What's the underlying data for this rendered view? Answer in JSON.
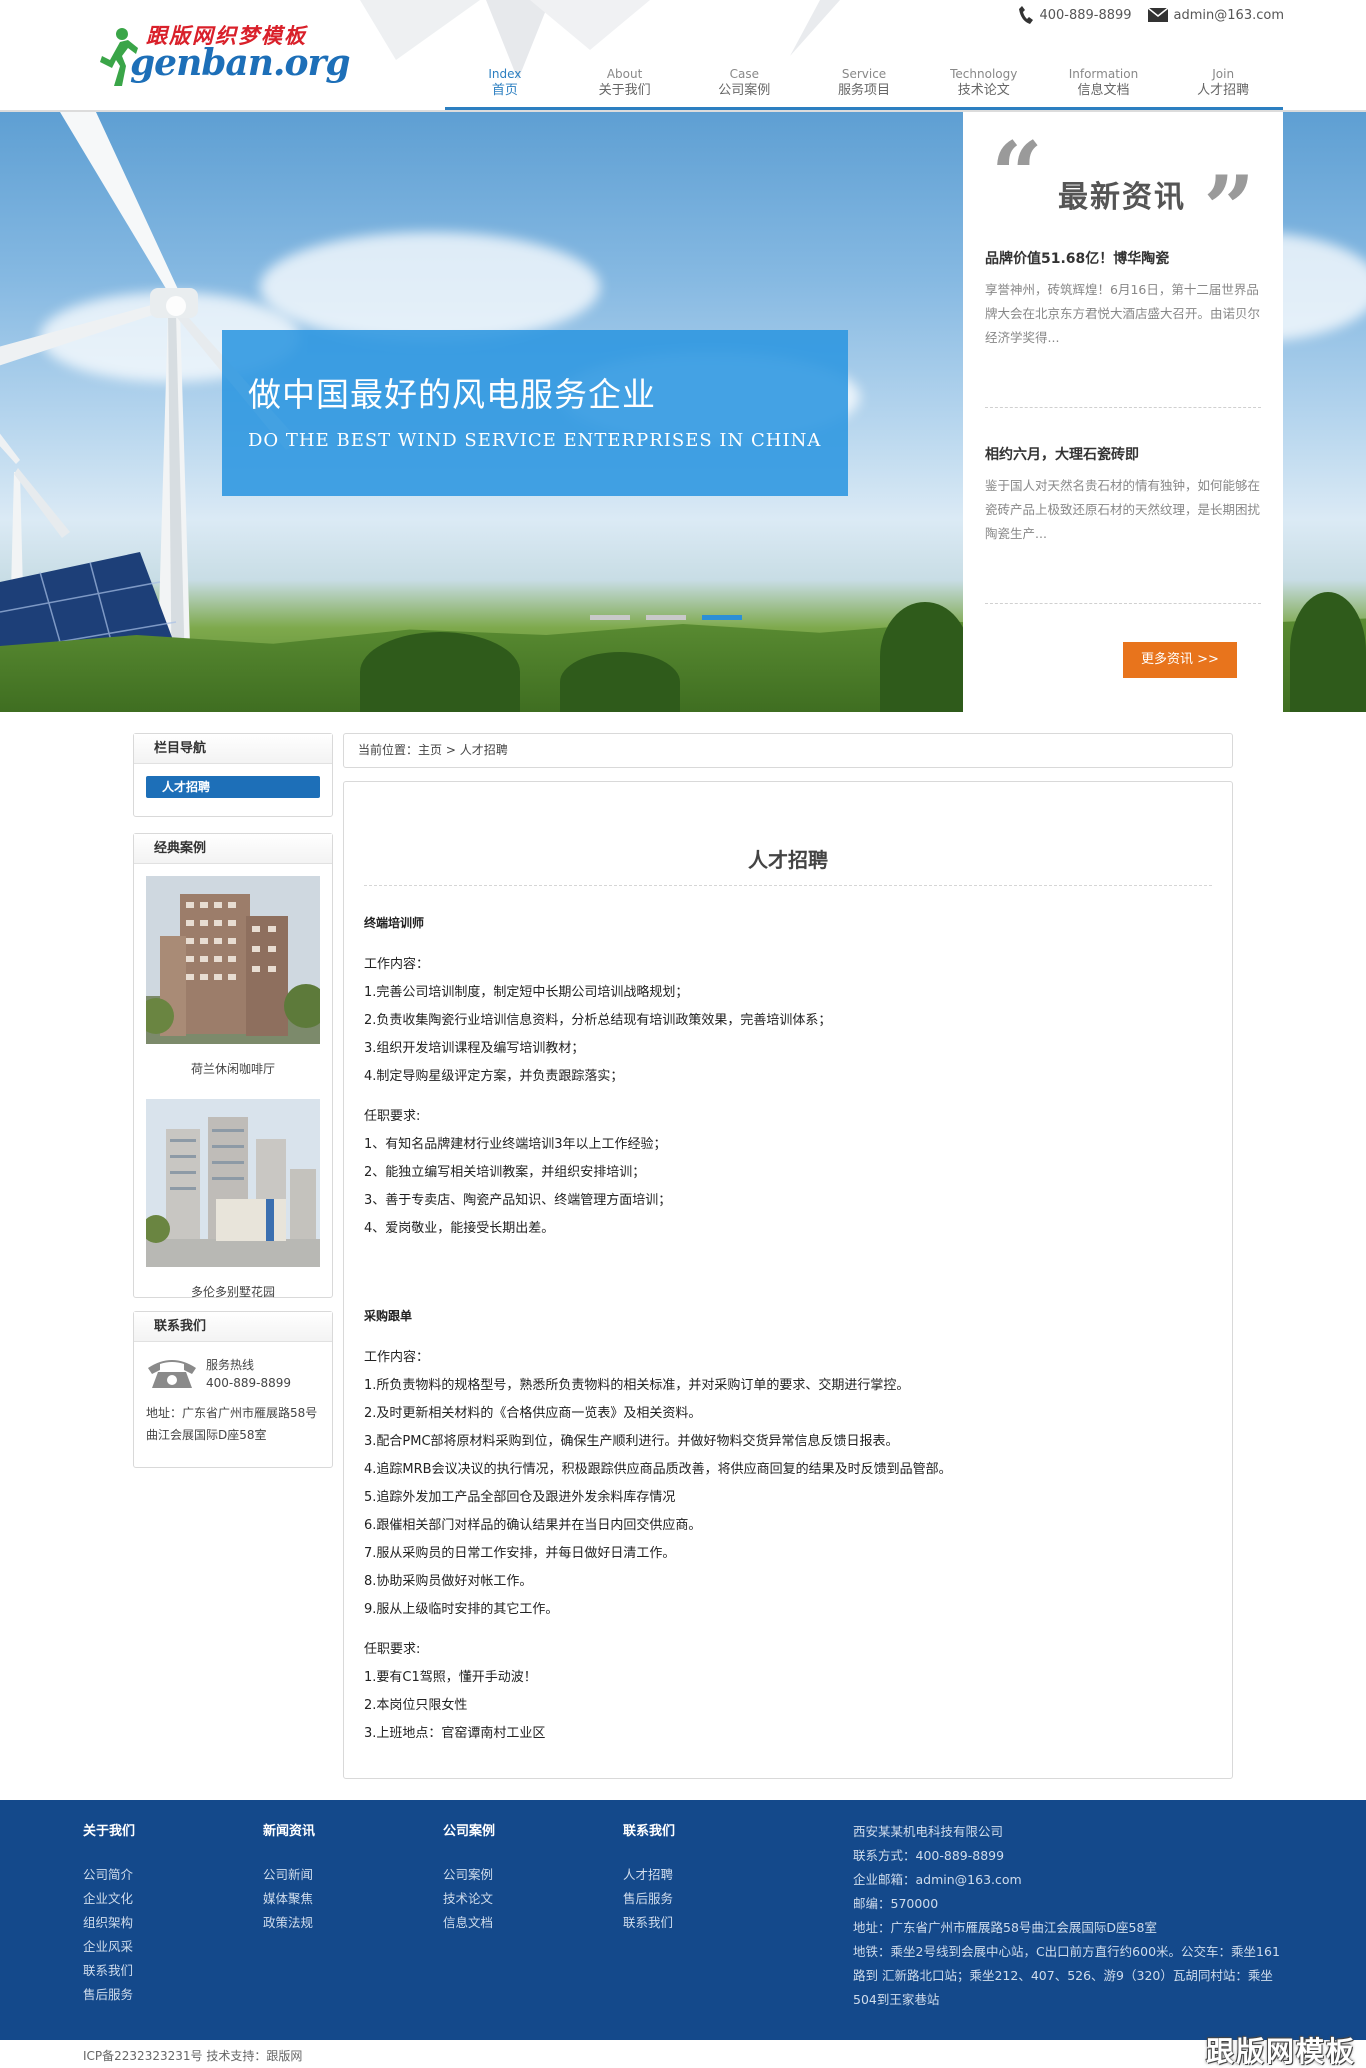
{
  "header": {
    "logo_cn": "跟版网织梦模板",
    "logo_en": "genban.org",
    "phone": "400-889-8899",
    "email": "admin@163.com"
  },
  "nav": [
    {
      "en": "Index",
      "cn": "首页",
      "active": true
    },
    {
      "en": "About",
      "cn": "关于我们"
    },
    {
      "en": "Case",
      "cn": "公司案例"
    },
    {
      "en": "Service",
      "cn": "服务项目"
    },
    {
      "en": "Technology",
      "cn": "技术论文"
    },
    {
      "en": "Information",
      "cn": "信息文档"
    },
    {
      "en": "Join",
      "cn": "人才招聘"
    }
  ],
  "banner": {
    "slogan_cn": "做中国最好的风电服务企业",
    "slogan_en": "DO THE BEST WIND SERVICE ENTERPRISES IN CHINA",
    "slide_count": 3,
    "active_slide": 3
  },
  "news_panel": {
    "title": "最新资讯",
    "items": [
      {
        "title": "品牌价值51.68亿！博华陶瓷",
        "text": "享誉神州，砖筑辉煌！6月16日，第十二届世界品牌大会在北京东方君悦大酒店盛大召开。由诺贝尔经济学奖得..."
      },
      {
        "title": "相约六月，大理石瓷砖即",
        "text": "鉴于国人对天然名贵石材的情有独钟，如何能够在瓷砖产品上极致还原石材的天然纹理，是长期困扰陶瓷生产..."
      }
    ],
    "more_label": "更多资讯 >>"
  },
  "sidebar": {
    "nav_title": "栏目导航",
    "nav_item": "人才招聘",
    "cases_title": "经典案例",
    "cases": [
      {
        "caption": "荷兰休闲咖啡厅"
      },
      {
        "caption": "多伦多别墅花园"
      }
    ],
    "contact_title": "联系我们",
    "hotline_label": "服务热线",
    "hotline": "400-889-8899",
    "address": "地址：广东省广州市雁展路58号曲江会展国际D座58室"
  },
  "breadcrumb": {
    "prefix": "当前位置：",
    "home": "主页",
    "sep": ">",
    "current": "人才招聘"
  },
  "content": {
    "title": "人才招聘",
    "jobs": [
      {
        "title": "终端培训师",
        "duties_label": "工作内容：",
        "duties": [
          "1.完善公司培训制度，制定短中长期公司培训战略规划；",
          "2.负责收集陶瓷行业培训信息资料，分析总结现有培训政策效果，完善培训体系；",
          "3.组织开发培训课程及编写培训教材；",
          "4.制定导购星级评定方案，并负责跟踪落实；"
        ],
        "req_label": "任职要求:",
        "reqs": [
          "1、有知名品牌建材行业终端培训3年以上工作经验；",
          "2、能独立编写相关培训教案，并组织安排培训；",
          "3、善于专卖店、陶瓷产品知识、终端管理方面培训；",
          "4、爱岗敬业，能接受长期出差。"
        ]
      },
      {
        "title": "采购跟单",
        "duties_label": "工作内容：",
        "duties": [
          "1.所负责物料的规格型号，熟悉所负责物料的相关标准，并对采购订单的要求、交期进行掌控。",
          "2.及时更新相关材料的《合格供应商一览表》及相关资料。",
          "3.配合PMC部将原材料采购到位，确保生产顺利进行。并做好物料交货异常信息反馈日报表。",
          "4.追踪MRB会议决议的执行情况，积极跟踪供应商品质改善，将供应商回复的结果及时反馈到品管部。",
          "5.追踪外发加工产品全部回仓及跟进外发余料库存情况",
          "6.跟催相关部门对样品的确认结果并在当日内回交供应商。",
          "7.服从采购员的日常工作安排，并每日做好日清工作。",
          "8.协助采购员做好对帐工作。",
          "9.服从上级临时安排的其它工作。"
        ],
        "req_label": "任职要求:",
        "reqs": [
          "1.要有C1驾照，懂开手动波！",
          "2.本岗位只限女性",
          "3.上班地点：官窑谭南村工业区"
        ]
      }
    ]
  },
  "footer": {
    "columns": [
      {
        "title": "关于我们",
        "links": [
          "公司简介",
          "企业文化",
          "组织架构",
          "企业风采",
          "联系我们",
          "售后服务"
        ]
      },
      {
        "title": "新闻资讯",
        "links": [
          "公司新闻",
          "媒体聚焦",
          "政策法规"
        ]
      },
      {
        "title": "公司案例",
        "links": [
          "公司案例",
          "技术论文",
          "信息文档"
        ]
      },
      {
        "title": "联系我们",
        "links": [
          "人才招聘",
          "售后服务",
          "联系我们"
        ]
      }
    ],
    "info": [
      "西安某某机电科技有限公司",
      "联系方式：400-889-8899",
      "企业邮箱：admin@163.com",
      "邮编：570000",
      "地址：广东省广州市雁展路58号曲江会展国际D座58室",
      "地铁：乘坐2号线到会展中心站，C出口前方直行约600米。公交车：乘坐161路到 汇新路北口站；乘坐212、407、526、游9（320）瓦胡同村站：乘坐504到王家巷站"
    ],
    "icp": "ICP备2232323231号 技术支持：跟版网",
    "watermark": "跟版网模板"
  },
  "colors": {
    "brand_blue": "#2c7fc1",
    "footer_blue": "#14498b",
    "accent_orange": "#e8741c",
    "slogan_blue": "#2c96e0"
  }
}
